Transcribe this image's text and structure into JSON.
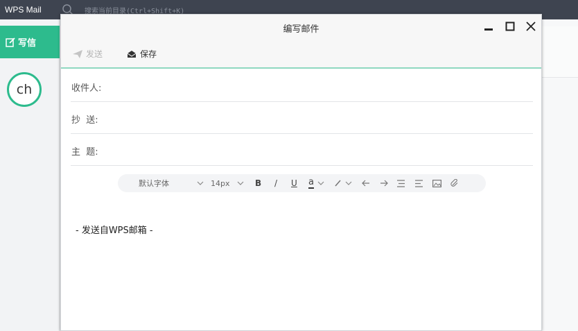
{
  "app": {
    "title": "WPS Mail",
    "search_placeholder": "搜索当前目录(Ctrl+Shift+K)",
    "compose_label": "写信",
    "avatar_initials": "ch"
  },
  "window": {
    "title": "编写邮件"
  },
  "toolbar": {
    "send_label": "发送",
    "save_label": "保存"
  },
  "fields": {
    "to_label": "收件人:",
    "cc_label": "抄  送:",
    "subject_label": "主  题:"
  },
  "format_bar": {
    "font_family": "默认字体",
    "font_size": "14px",
    "bold": "B",
    "italic": "/",
    "underline": "U",
    "font_color": "a"
  },
  "body": {
    "signature": "- 发送自WPS邮箱 -"
  },
  "colors": {
    "accent": "#2dbb8d",
    "topbar": "#3e4450"
  }
}
